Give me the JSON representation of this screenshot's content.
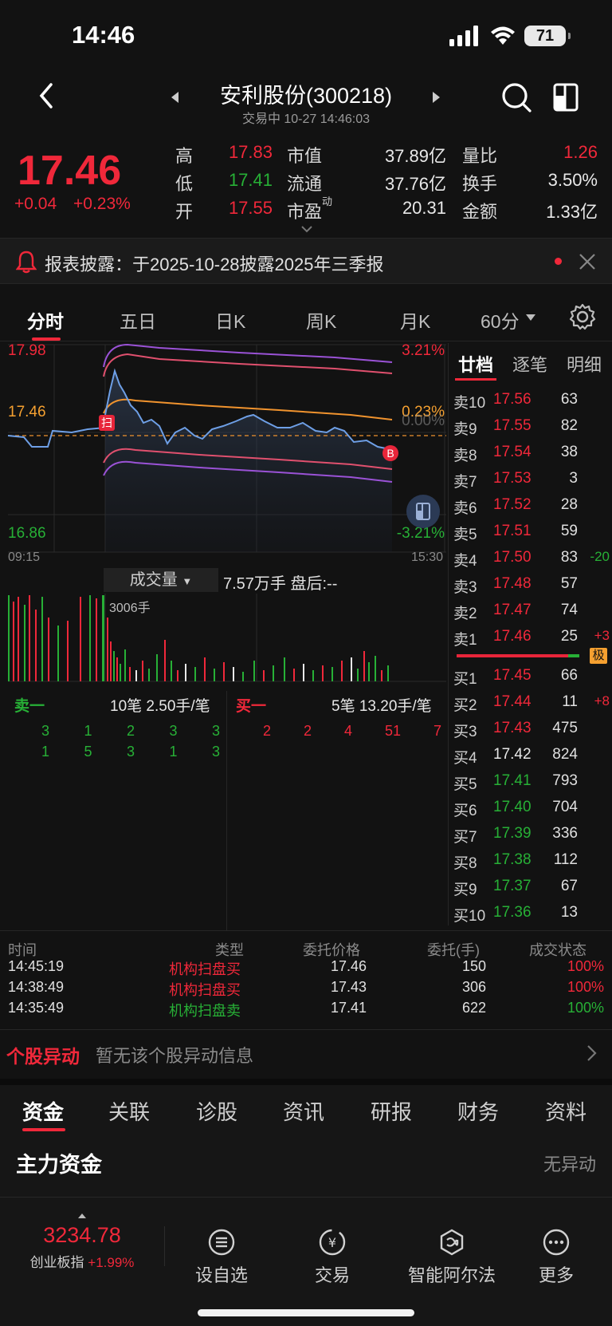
{
  "status_bar": {
    "time": "14:46",
    "battery": "71"
  },
  "header": {
    "title": "安利股份(300218)",
    "subtitle": "交易中 10-27 14:46:03"
  },
  "quote": {
    "price": "17.46",
    "change": "+0.04",
    "change_pct": "+0.23%",
    "high_label": "高",
    "high": "17.83",
    "low_label": "低",
    "low": "17.41",
    "open_label": "开",
    "open": "17.55",
    "mktcap_label": "市值",
    "mktcap": "37.89亿",
    "float_label": "流通",
    "float": "37.76亿",
    "pe_label": "市盈",
    "pe_sup": "动",
    "pe": "20.31",
    "volratio_label": "量比",
    "volratio": "1.26",
    "turnover_label": "换手",
    "turnover": "3.50%",
    "amount_label": "金额",
    "amount": "1.33亿"
  },
  "notice": {
    "text": "报表披露：于2025-10-28披露2025年三季报"
  },
  "chart_tabs": [
    "分时",
    "五日",
    "日K",
    "周K",
    "月K",
    "60分"
  ],
  "intraday": {
    "price_top": "17.98",
    "price_bottom": "16.86",
    "price_mid": "17.46",
    "pct_top": "3.21%",
    "pct_bottom": "-3.21%",
    "pct_mid": "0.23%",
    "pct_zero": "0.00%",
    "time_start": "09:15",
    "time_end": "15:30",
    "marker_scan": "扫",
    "marker_b": "B"
  },
  "volume": {
    "label": "成交量",
    "info": "7.57万手  盘后:--",
    "peak": "3006手"
  },
  "ticks": {
    "sell_title": "卖一",
    "sell_info": "10笔  2.50手/笔",
    "buy_title": "买一",
    "buy_info": "5笔  13.20手/笔",
    "sell_rows": [
      [
        "3",
        "1",
        "2",
        "3",
        "3"
      ],
      [
        "1",
        "5",
        "3",
        "1",
        "3"
      ]
    ],
    "buy_rows": [
      [
        "2",
        "2",
        "4",
        "51",
        "7"
      ]
    ]
  },
  "orderbook": {
    "tabs": [
      "廿档",
      "逐笔",
      "明细"
    ],
    "asks": [
      {
        "label": "卖10",
        "price": "17.56",
        "vol": "63",
        "delta": ""
      },
      {
        "label": "卖9",
        "price": "17.55",
        "vol": "82",
        "delta": ""
      },
      {
        "label": "卖8",
        "price": "17.54",
        "vol": "38",
        "delta": ""
      },
      {
        "label": "卖7",
        "price": "17.53",
        "vol": "3",
        "delta": ""
      },
      {
        "label": "卖6",
        "price": "17.52",
        "vol": "28",
        "delta": ""
      },
      {
        "label": "卖5",
        "price": "17.51",
        "vol": "59",
        "delta": ""
      },
      {
        "label": "卖4",
        "price": "17.50",
        "vol": "83",
        "delta": "-20"
      },
      {
        "label": "卖3",
        "price": "17.48",
        "vol": "57",
        "delta": ""
      },
      {
        "label": "卖2",
        "price": "17.47",
        "vol": "74",
        "delta": ""
      },
      {
        "label": "卖1",
        "price": "17.46",
        "vol": "25",
        "delta": "+3"
      }
    ],
    "badge": "极",
    "bids": [
      {
        "label": "买1",
        "price": "17.45",
        "vol": "66",
        "delta": "",
        "color": "red"
      },
      {
        "label": "买2",
        "price": "17.44",
        "vol": "11",
        "delta": "+8",
        "color": "red"
      },
      {
        "label": "买3",
        "price": "17.43",
        "vol": "475",
        "delta": "",
        "color": "red"
      },
      {
        "label": "买4",
        "price": "17.42",
        "vol": "824",
        "delta": "",
        "color": "white"
      },
      {
        "label": "买5",
        "price": "17.41",
        "vol": "793",
        "delta": "",
        "color": "green"
      },
      {
        "label": "买6",
        "price": "17.40",
        "vol": "704",
        "delta": "",
        "color": "green"
      },
      {
        "label": "买7",
        "price": "17.39",
        "vol": "336",
        "delta": "",
        "color": "green"
      },
      {
        "label": "买8",
        "price": "17.38",
        "vol": "112",
        "delta": "",
        "color": "green"
      },
      {
        "label": "买9",
        "price": "17.37",
        "vol": "67",
        "delta": "",
        "color": "green"
      },
      {
        "label": "买10",
        "price": "17.36",
        "vol": "13",
        "delta": "",
        "color": "green"
      }
    ]
  },
  "monitor": {
    "headers": [
      "时间",
      "类型",
      "委托价格",
      "委托(手)",
      "成交状态"
    ],
    "rows": [
      {
        "time": "14:45:19",
        "type": "机构扫盘买",
        "price": "17.46",
        "qty": "150",
        "status": "100%",
        "color": "red"
      },
      {
        "time": "14:38:49",
        "type": "机构扫盘买",
        "price": "17.43",
        "qty": "306",
        "status": "100%",
        "color": "red"
      },
      {
        "time": "14:35:49",
        "type": "机构扫盘卖",
        "price": "17.41",
        "qty": "622",
        "status": "100%",
        "color": "green"
      }
    ]
  },
  "anomaly": {
    "title": "个股异动",
    "message": "暂无该个股异动信息"
  },
  "bottom_tabs": [
    "资金",
    "关联",
    "诊股",
    "资讯",
    "研报",
    "财务",
    "资料"
  ],
  "fund": {
    "title": "主力资金",
    "right": "无异动"
  },
  "bottom_bar": {
    "index_value": "3234.78",
    "index_name": "创业板指",
    "index_pct": "+1.99%",
    "items": [
      "设自选",
      "交易",
      "智能阿尔法",
      "更多"
    ]
  }
}
